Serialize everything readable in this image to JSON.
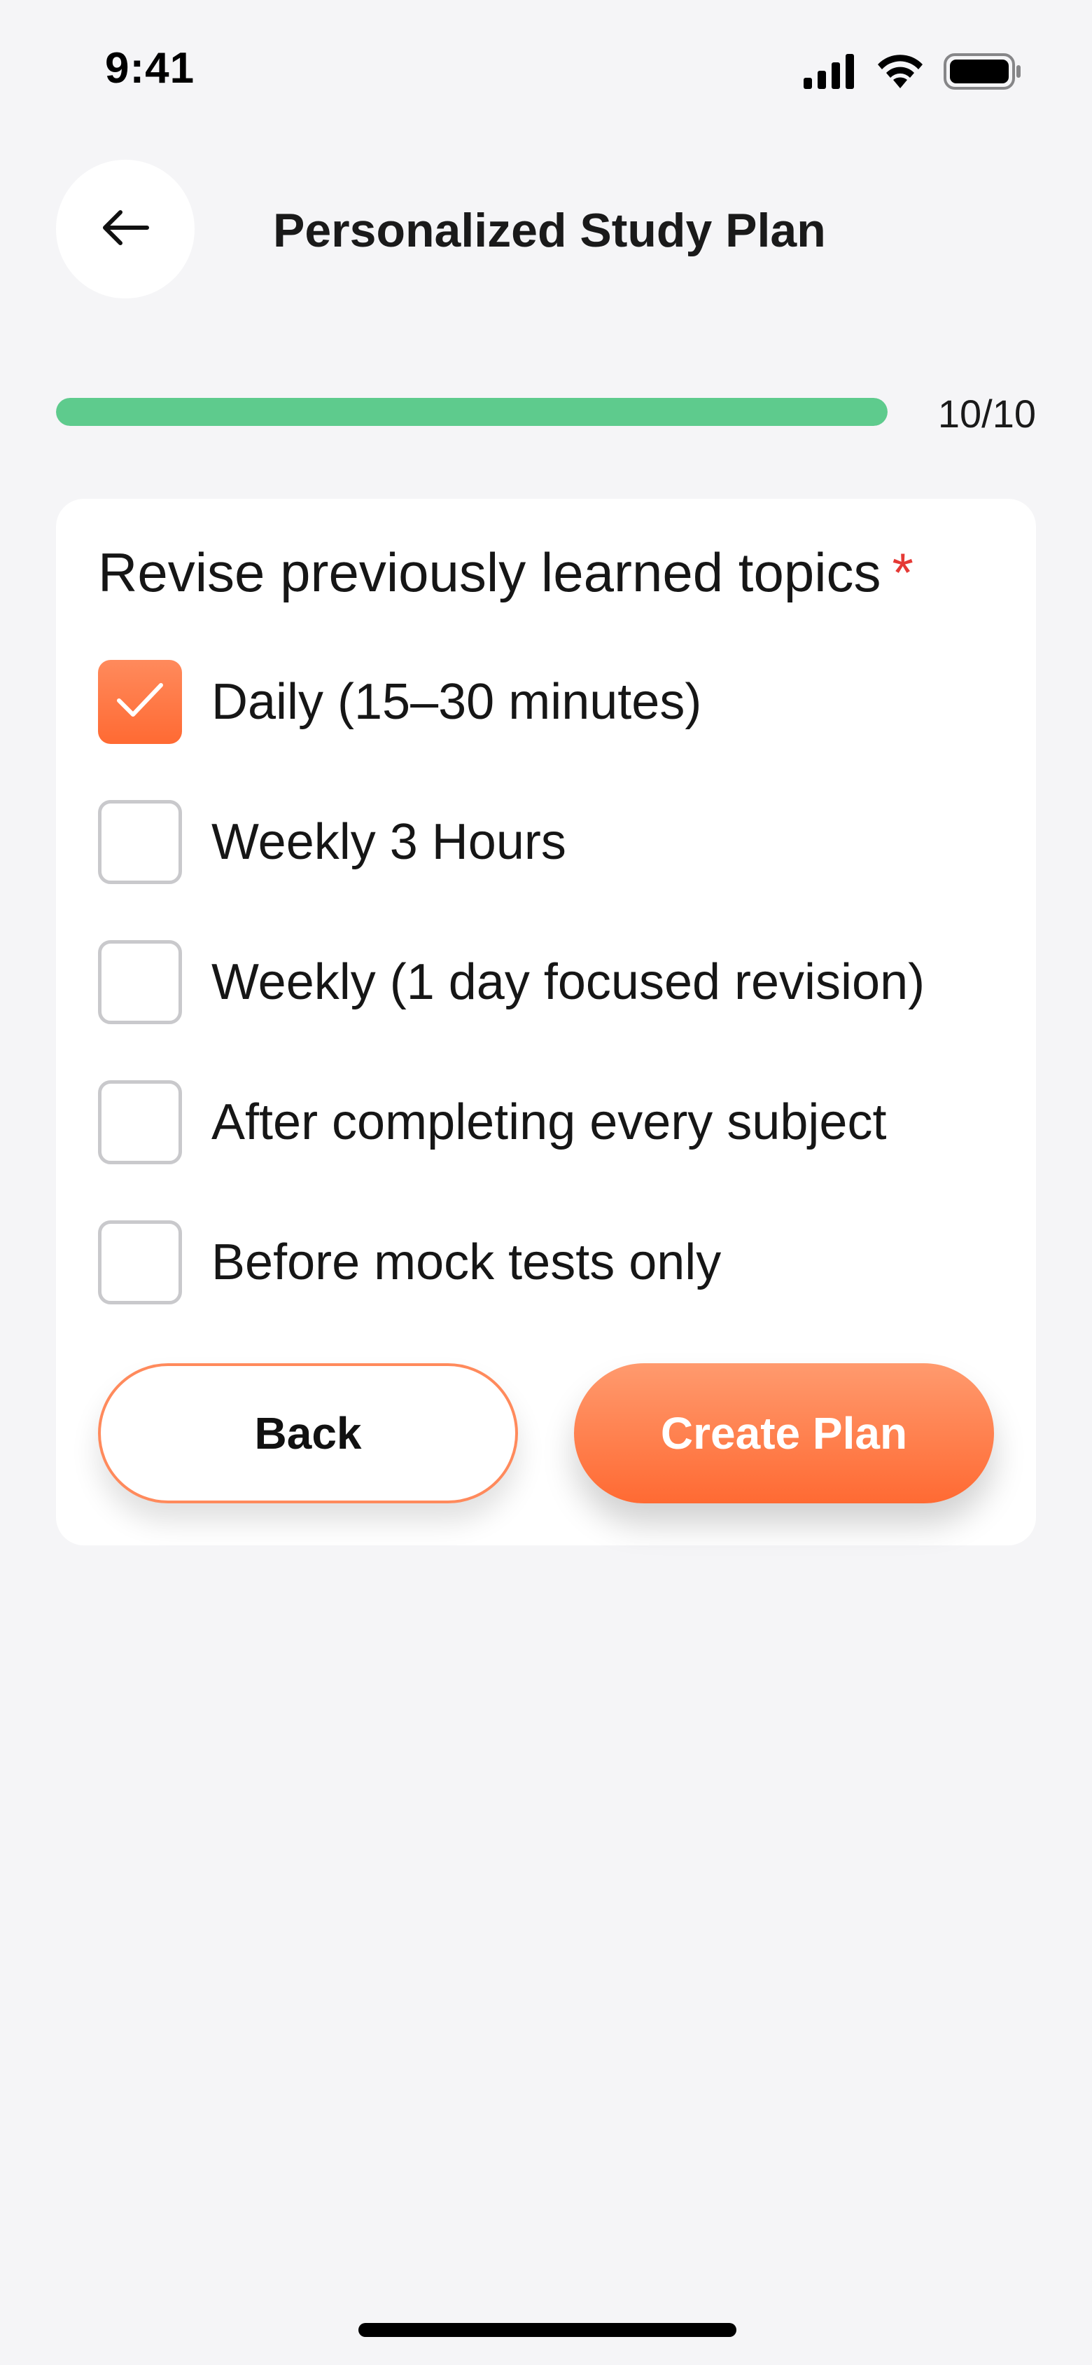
{
  "status_bar": {
    "time": "9:41",
    "icons": [
      "cellular-signal-icon",
      "wifi-icon",
      "battery-icon"
    ]
  },
  "header": {
    "back_icon": "arrow-left-icon",
    "title": "Personalized Study Plan"
  },
  "progress": {
    "text": "10/10",
    "fraction": 1.0,
    "fill_color": "#5ecb8d"
  },
  "question": {
    "text": "Revise previously learned topics",
    "required_mark": "*"
  },
  "options": [
    {
      "label": "Daily (15–30 minutes)",
      "checked": true
    },
    {
      "label": "Weekly 3 Hours",
      "checked": false
    },
    {
      "label": "Weekly (1 day focused revision)",
      "checked": false
    },
    {
      "label": "After completing every subject",
      "checked": false
    },
    {
      "label": "Before mock tests only",
      "checked": false
    }
  ],
  "buttons": {
    "back_label": "Back",
    "create_label": "Create Plan"
  },
  "colors": {
    "accent": "#ff6a33",
    "progress": "#5ecb8d",
    "required": "#e53935",
    "background": "#f5f5f7"
  }
}
